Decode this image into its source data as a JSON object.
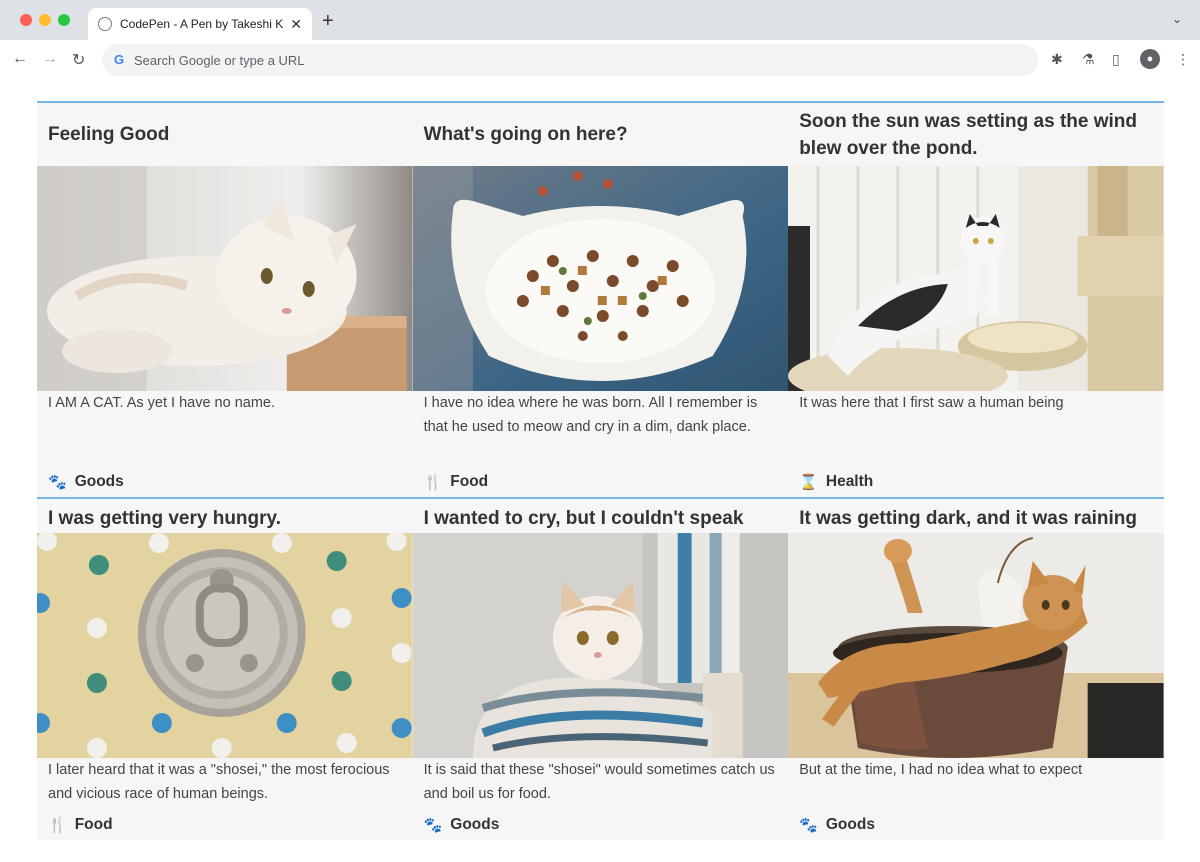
{
  "browser": {
    "tab_title": "CodePen - A Pen by Takeshi K",
    "omnibox_placeholder": "Search Google or type a URL"
  },
  "cards": [
    {
      "title": "Feeling Good",
      "text": "I AM A CAT. As yet I have no name.",
      "category": "Goods",
      "category_icon": "paw-icon"
    },
    {
      "title": "What's going on here?",
      "text": "I have no idea where he was born. All I remember is that he used to meow and cry in a dim, dank place.",
      "category": "Food",
      "category_icon": "utensils-icon"
    },
    {
      "title": "Soon the sun was setting as the wind blew over the pond.",
      "text": "It was here that I first saw a human being",
      "category": "Health",
      "category_icon": "hourglass-icon"
    },
    {
      "title": "I was getting very hungry.",
      "text": "I later heard that it was a \"shosei,\" the most ferocious and vicious race of human beings.",
      "category": "Food",
      "category_icon": "utensils-icon"
    },
    {
      "title": "I wanted to cry, but I couldn't speak",
      "text": "It is said that these \"shosei\" would sometimes catch us and boil us for food.",
      "category": "Goods",
      "category_icon": "paw-icon"
    },
    {
      "title": "It was getting dark, and it was raining",
      "text": "But at the time, I had no idea what to expect",
      "category": "Goods",
      "category_icon": "paw-icon"
    }
  ],
  "colors": {
    "accent_border": "#74b7e5",
    "icon_blue": "#3b94d9",
    "card_bg": "#f7f6f7"
  }
}
